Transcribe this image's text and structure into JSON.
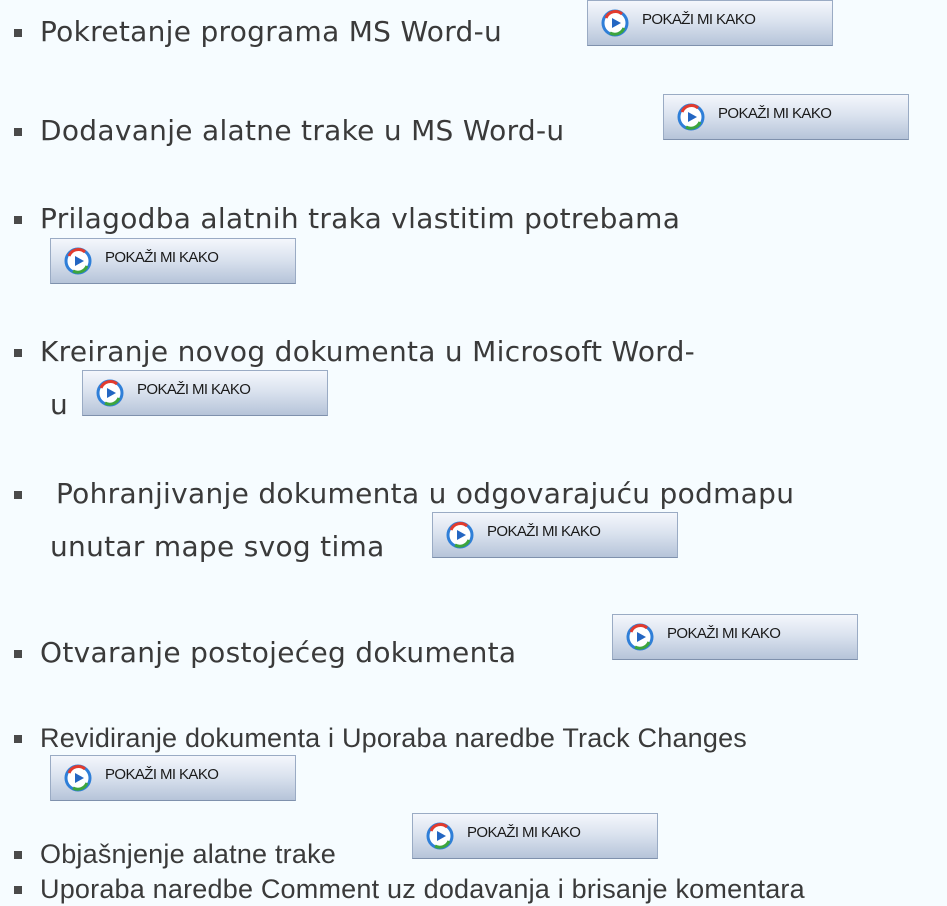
{
  "button": {
    "label": "POKAŽI MI KAKO",
    "icon": "media-play-icon"
  },
  "colors": {
    "background": "#f6fcff",
    "text": "#3a3a3a",
    "button_top": "#f4f7fc",
    "button_bottom": "#b6c4d9"
  },
  "items": [
    {
      "lines": [
        "Pokretanje programa MS Word-u"
      ]
    },
    {
      "lines": [
        "Dodavanje alatne trake u MS Word-u"
      ]
    },
    {
      "lines": [
        "Prilagodba alatnih traka vlastitim potrebama"
      ]
    },
    {
      "lines": [
        "Kreiranje novog dokumenta u Microsoft Word-",
        "u"
      ]
    },
    {
      "lines": [
        "Pohranjivanje dokumenta u odgovarajuću podmapu",
        "unutar mape svog tima"
      ]
    },
    {
      "lines": [
        "Otvaranje  postojećeg dokumenta"
      ]
    },
    {
      "lines": [
        "Revidiranje  dokumenta  i  Uporaba  naredbe  Track  Changes"
      ]
    },
    {
      "lines": [
        "Objašnjenje alatne trake"
      ]
    },
    {
      "lines": [
        "Uporaba naredbe Comment uz dodavanja i brisanje komentara"
      ]
    }
  ]
}
